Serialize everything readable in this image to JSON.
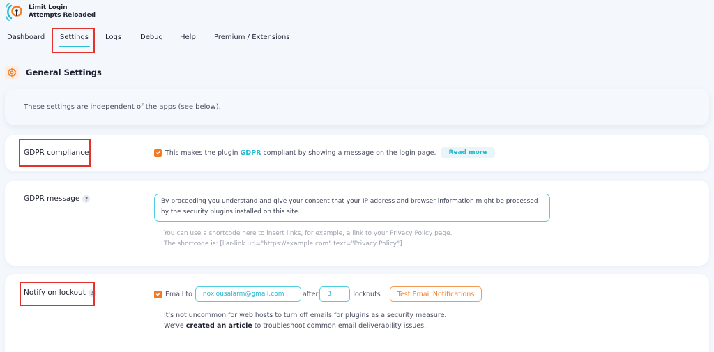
{
  "app": {
    "title_line1": "Limit Login",
    "title_line2": "Attempts Reloaded",
    "logo_icon": "keyhole-signal-logo"
  },
  "nav": {
    "tabs": [
      {
        "label": "Dashboard",
        "active": false
      },
      {
        "label": "Settings",
        "active": true
      },
      {
        "label": "Logs",
        "active": false
      },
      {
        "label": "Debug",
        "active": false
      },
      {
        "label": "Help",
        "active": false
      },
      {
        "label": "Premium / Extensions",
        "active": false
      }
    ]
  },
  "section": {
    "icon": "gear-icon",
    "title": "General Settings",
    "intro": "These settings are independent of the apps (see below)."
  },
  "gdpr_compliance": {
    "label": "GDPR compliance",
    "checked": true,
    "text_before": "This makes the plugin",
    "link": "GDPR",
    "text_after": "compliant by showing a message on the login page.",
    "read_more": "Read more"
  },
  "gdpr_message": {
    "label": "GDPR message",
    "help": "?",
    "value": "By proceeding you understand and give your consent that your IP address and browser information might be processed by the security plugins installed on this site.",
    "hint_line1": "You can use a shortcode here to insert links, for example, a link to your Privacy Policy page.",
    "hint_line2": "The shortcode is: [llar-link url=\"https://example.com\" text=\"Privacy Policy\"]"
  },
  "notify_lockout": {
    "label": "Notify on lockout",
    "help": "?",
    "checked": true,
    "email_label": "Email to",
    "email_value": "noxiousalarm@gmail.com",
    "after_label": "after",
    "count_value": "3",
    "lockouts_label": "lockouts",
    "test_button": "Test Email Notifications",
    "note_line1": "It's not uncommon for web hosts to turn off emails for plugins as a security measure.",
    "note_prefix": "We've",
    "note_link": "created an article",
    "note_suffix": "to troubleshoot common email deliverability issues."
  },
  "colors": {
    "accent": "#22b8cf",
    "orange": "#f37a22",
    "highlight_box": "#e3312c",
    "background": "#f4f8fd"
  }
}
